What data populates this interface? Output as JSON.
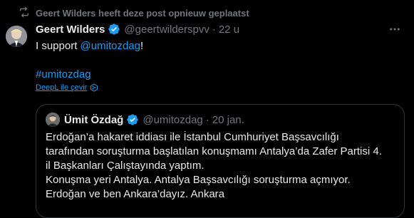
{
  "repost": {
    "icon": "repost-icon",
    "text": "Geert Wilders heeft deze post opnieuw geplaatst"
  },
  "tweet": {
    "author_name": "Geert Wilders",
    "handle": "@geertwilderspvv",
    "separator": "·",
    "time": "22 u",
    "text_before": "I support ",
    "mention": "@umitozdag",
    "text_after": "!",
    "hashtag": "#umitozdag",
    "translate_label": "DeepL ile çevir"
  },
  "quote": {
    "author_name": "Ümit Özdağ",
    "handle": "@umitozdag",
    "separator": "·",
    "time": "20 jan.",
    "lines": [
      "Erdoğan’a hakaret iddiası ile İstanbul Cumhuriyet Başsavcılığı",
      "tarafından soruşturma başlatılan konuşmamı Antalya’da Zafer Partisi 4.",
      "il Başkanları Çalıştayında yaptım.",
      "Konuşma yeri Antalya. Antalya Başsavcılığı soruşturma açmıyor.",
      "Erdoğan ve ben Ankara’dayız. Ankara"
    ]
  },
  "colors": {
    "background": "#000000",
    "text": "#e7e9ea",
    "muted": "#71767b",
    "link": "#1d9bf0",
    "verified": "#1d9bf0",
    "border": "#2f3336"
  }
}
